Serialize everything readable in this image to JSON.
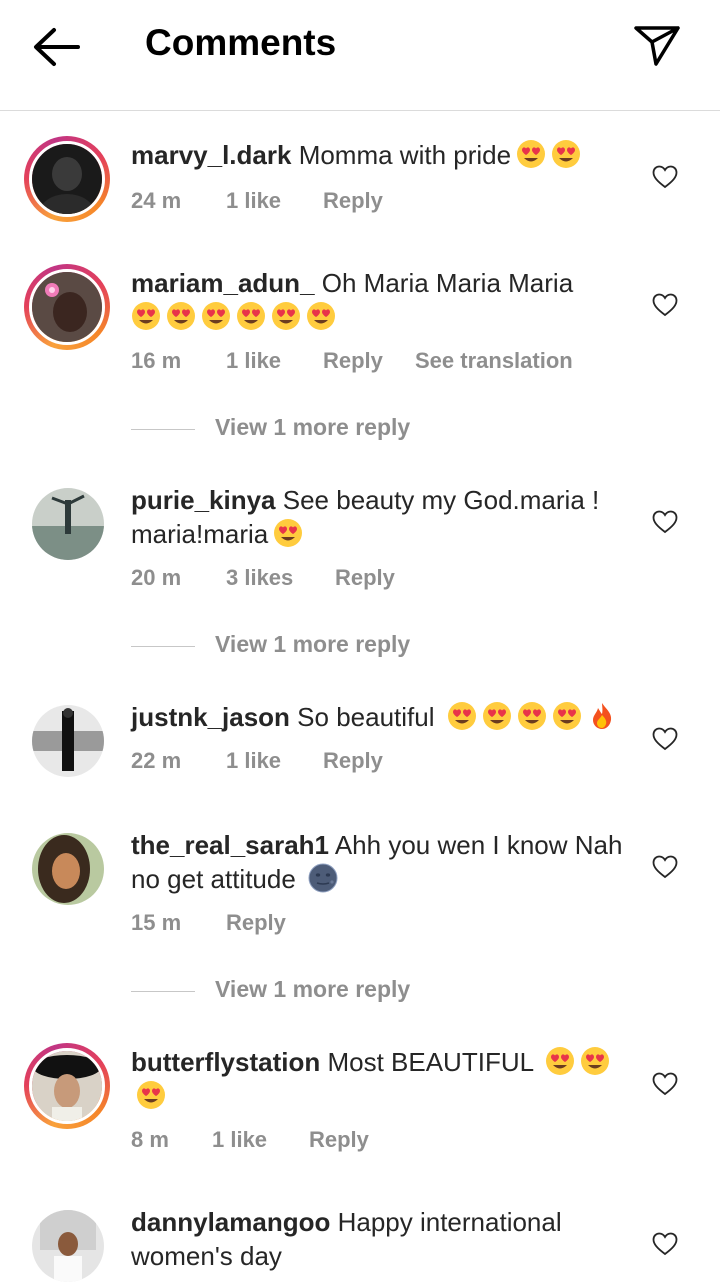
{
  "header": {
    "title": "Comments",
    "back_icon": "arrow-left-icon",
    "direct_icon": "paper-plane-icon"
  },
  "comments": [
    {
      "username": "marvy_l.dark",
      "text": "Momma with pride",
      "emojis": [
        "heart-eyes",
        "heart-eyes"
      ],
      "time": "24 m",
      "likes": "1 like",
      "reply": "Reply",
      "translation": "",
      "story_ring": true
    },
    {
      "username": "mariam_adun_",
      "text": "Oh Maria Maria Maria",
      "emojis": [
        "heart-eyes",
        "heart-eyes",
        "heart-eyes",
        "heart-eyes",
        "heart-eyes",
        "heart-eyes"
      ],
      "time": "16 m",
      "likes": "1 like",
      "reply": "Reply",
      "translation": "See translation",
      "story_ring": true,
      "view_more": "View 1 more reply"
    },
    {
      "username": "purie_kinya",
      "text": "See beauty my God.maria ! maria!maria",
      "emojis": [
        "heart-eyes"
      ],
      "time": "20 m",
      "likes": "3 likes",
      "reply": "Reply",
      "translation": "",
      "story_ring": false,
      "view_more": "View 1 more reply"
    },
    {
      "username": "justnk_jason",
      "text": "So beautiful ",
      "emojis": [
        "heart-eyes",
        "heart-eyes",
        "heart-eyes",
        "heart-eyes",
        "fire"
      ],
      "time": "22 m",
      "likes": "1 like",
      "reply": "Reply",
      "translation": "",
      "story_ring": false
    },
    {
      "username": "the_real_sarah1",
      "text": "Ahh you wen I know Nah no get attitude ",
      "emojis": [
        "new-moon-face"
      ],
      "time": "15 m",
      "likes": "",
      "reply": "Reply",
      "translation": "",
      "story_ring": false,
      "view_more": "View 1 more reply"
    },
    {
      "username": "butterflystation",
      "text": "Most BEAUTIFUL ",
      "emojis": [
        "heart-eyes",
        "heart-eyes",
        "heart-eyes"
      ],
      "time": "8 m",
      "likes": "1 like",
      "reply": "Reply",
      "translation": "",
      "story_ring": true
    },
    {
      "username": "dannylamangoo",
      "text": "Happy international women's day",
      "emojis": [],
      "time": "",
      "likes": "",
      "reply": "",
      "translation": "",
      "story_ring": false
    }
  ],
  "colors": {
    "text": "#262626",
    "meta": "#8e8e8e",
    "divider": "#dbdbdb",
    "story_gradient_start": "#f9a13b",
    "story_gradient_end": "#c13584"
  }
}
